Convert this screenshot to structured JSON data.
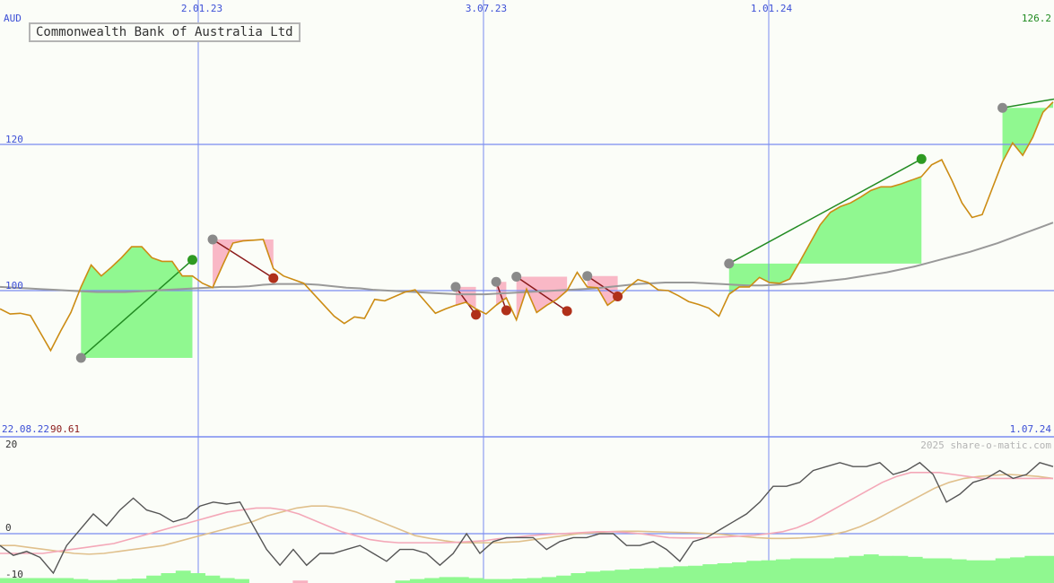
{
  "chart_data": [
    {
      "type": "line",
      "title": "Commonwealth Bank of Australia Ltd",
      "currency": "AUD",
      "x_tick_labels": [
        "2.01.23",
        "3.07.23",
        "1.01.24"
      ],
      "y_tick_labels": [
        "120",
        "100"
      ],
      "date_range": {
        "start": "22.08.22",
        "end": "1.07.24"
      },
      "start_value": "90.61",
      "last_value": "126.2",
      "ylim": [
        80,
        140
      ],
      "grid": true,
      "colors": {
        "price": "#cc8c14",
        "moving_average": "#999999",
        "gain_fill": "#90f890",
        "loss_fill": "#f8b0c0",
        "win_trade": "#228b22",
        "loss_trade": "#8b1a1a",
        "grid": "#7a8cf0"
      },
      "price": [
        97.5,
        96.8,
        96.9,
        96.6,
        94.2,
        91.8,
        94.5,
        97.0,
        100.5,
        103.5,
        102.0,
        103.2,
        104.5,
        106.0,
        106.0,
        104.5,
        104.0,
        104.0,
        102.0,
        102.0,
        101.0,
        100.4,
        103.5,
        106.5,
        106.8,
        106.9,
        107.0,
        103.0,
        102.0,
        101.5,
        101.0,
        99.5,
        98.0,
        96.5,
        95.5,
        96.4,
        96.2,
        98.8,
        98.6,
        99.2,
        99.8,
        100.1,
        98.5,
        96.9,
        97.5,
        98.0,
        98.4,
        97.5,
        96.8,
        98.0,
        99.0,
        96.0,
        100.2,
        97.0,
        98.0,
        98.8,
        100.0,
        102.5,
        100.5,
        100.4,
        98.0,
        99.0,
        100.4,
        101.5,
        101.1,
        100.1,
        100.0,
        99.3,
        98.5,
        98.1,
        97.6,
        96.5,
        99.5,
        100.5,
        100.5,
        101.8,
        101.1,
        101.0,
        101.6,
        104.0,
        106.5,
        109.0,
        110.7,
        111.5,
        112.0,
        112.8,
        113.7,
        114.2,
        114.2,
        114.6,
        115.1,
        115.6,
        117.2,
        117.9,
        115.1,
        112.0,
        110.0,
        110.4,
        114.0,
        117.6,
        120.2,
        118.5,
        121.0,
        124.4,
        125.8
      ],
      "moving_average": [
        100.5,
        100.4,
        100.3,
        100.2,
        100.1,
        100.0,
        99.9,
        99.8,
        99.8,
        99.8,
        99.9,
        100.0,
        100.1,
        100.2,
        100.3,
        100.4,
        100.5,
        100.5,
        100.6,
        100.8,
        100.9,
        100.9,
        100.9,
        100.8,
        100.6,
        100.4,
        100.3,
        100.1,
        100.0,
        99.9,
        99.8,
        99.7,
        99.6,
        99.5,
        99.5,
        99.5,
        99.6,
        99.7,
        99.8,
        99.9,
        100.0,
        100.1,
        100.2,
        100.3,
        100.5,
        100.7,
        100.9,
        101.0,
        101.1,
        101.1,
        101.1,
        101.0,
        100.9,
        100.8,
        100.7,
        100.7,
        100.8,
        100.9,
        101.0,
        101.2,
        101.4,
        101.6,
        101.9,
        102.2,
        102.5,
        102.9,
        103.3,
        103.8,
        104.3,
        104.8,
        105.3,
        105.9,
        106.5,
        107.2,
        107.9,
        108.6,
        109.3
      ],
      "trades": [
        {
          "entry": 90.8,
          "exit": 104.2,
          "result": "win"
        },
        {
          "entry": 107.0,
          "exit": 101.7,
          "result": "loss"
        },
        {
          "entry": 100.5,
          "exit": 96.7,
          "result": "loss"
        },
        {
          "entry": 101.2,
          "exit": 97.3,
          "result": "loss"
        },
        {
          "entry": 101.9,
          "exit": 97.2,
          "result": "loss"
        },
        {
          "entry": 102.0,
          "exit": 99.2,
          "result": "loss"
        },
        {
          "entry": 103.7,
          "exit": 118.0,
          "result": "win"
        },
        {
          "entry": 125.0,
          "exit": null,
          "result": "open"
        }
      ]
    },
    {
      "type": "line",
      "title": "",
      "y_tick_labels": [
        "20",
        "0",
        "-10"
      ],
      "ylim": [
        -10,
        22
      ],
      "watermark": "2025 share-o-matic.com",
      "colors": {
        "oscillator": "#555555",
        "signal_fast": "#f4a8b8",
        "signal_slow": "#e0c08c",
        "volume": "#90f890",
        "volume_neg": "#f8b0c0"
      },
      "oscillator": [
        -3,
        -5.5,
        -4.5,
        -6,
        -10,
        -3,
        1,
        5,
        2,
        6,
        9,
        6,
        5,
        3,
        4,
        7,
        8,
        7.5,
        8,
        2,
        -4,
        -8,
        -4,
        -8,
        -5,
        -5,
        -4,
        -3,
        -5,
        -7,
        -4,
        -4,
        -5,
        -8,
        -5,
        0,
        -5,
        -2,
        -1,
        -1,
        -1,
        -4,
        -2,
        -1,
        -1,
        0,
        0,
        -3,
        -3,
        -2,
        -4,
        -7,
        -2,
        -1,
        1,
        3,
        5,
        8,
        12,
        12,
        13,
        16,
        17,
        18,
        17,
        17,
        18,
        15,
        16,
        18,
        15,
        8,
        10,
        13,
        14,
        16,
        14,
        15,
        18,
        17
      ],
      "signal_fast": [
        -5,
        -5,
        -5,
        -5,
        -4.5,
        -4,
        -3.5,
        -3,
        -2.5,
        -1.5,
        -0.5,
        0.5,
        1.5,
        2.5,
        3.5,
        4.5,
        5.5,
        6,
        6.5,
        6.5,
        6,
        5,
        3.5,
        2,
        0.5,
        -0.5,
        -1.5,
        -2,
        -2.3,
        -2.3,
        -2.3,
        -2.3,
        -2.2,
        -2,
        -1.8,
        -1.3,
        -1,
        -0.6,
        -0.3,
        -0.1,
        0.1,
        0.3,
        0.5,
        0.5,
        0.3,
        0,
        -0.5,
        -1,
        -1.1,
        -1.1,
        -1,
        -0.8,
        -0.6,
        -0.4,
        0,
        0.5,
        1.5,
        3,
        5,
        7,
        9,
        11,
        13,
        14.5,
        15.5,
        15.5,
        15.5,
        15,
        14.5,
        14,
        14,
        14,
        14,
        14,
        14
      ],
      "signal_slow": [
        -3,
        -3,
        -3.5,
        -4,
        -4.5,
        -5,
        -5.2,
        -5,
        -4.5,
        -4,
        -3.5,
        -3,
        -2,
        -1,
        0,
        1,
        2,
        3,
        4.5,
        5.5,
        6.5,
        7,
        7,
        6.5,
        5.5,
        4,
        2.5,
        1,
        -0.5,
        -1.2,
        -1.8,
        -2.3,
        -2.3,
        -2.3,
        -2.2,
        -2,
        -1.5,
        -1,
        -0.5,
        0,
        0.2,
        0.5,
        0.6,
        0.6,
        0.5,
        0.4,
        0.3,
        0.2,
        0,
        -0.3,
        -0.7,
        -1,
        -1.2,
        -1.2,
        -1.1,
        -0.8,
        -0.3,
        0.5,
        1.8,
        3.5,
        5.5,
        7.5,
        9.5,
        11.5,
        13,
        14,
        14.5,
        14.8,
        15,
        14.8,
        14.5,
        14
      ],
      "volume": [
        1,
        1,
        1,
        1,
        1,
        0.8,
        0.6,
        0.6,
        0.8,
        0.9,
        1.5,
        2,
        2.5,
        2,
        1.5,
        1,
        0.8,
        0,
        0,
        0,
        -0.5,
        0,
        0,
        0,
        0,
        0,
        0,
        0.5,
        0.8,
        1,
        1.2,
        1.2,
        1,
        0.8,
        0.8,
        0.9,
        1,
        1.2,
        1.5,
        2,
        2.3,
        2.5,
        2.7,
        2.9,
        3,
        3.2,
        3.4,
        3.5,
        3.8,
        4,
        4.2,
        4.5,
        4.6,
        4.8,
        5,
        5,
        5,
        5.2,
        5.5,
        5.8,
        5.5,
        5.5,
        5.3,
        5,
        5,
        4.8,
        4.6,
        4.6,
        5,
        5.2,
        5.5,
        5.5
      ]
    }
  ]
}
